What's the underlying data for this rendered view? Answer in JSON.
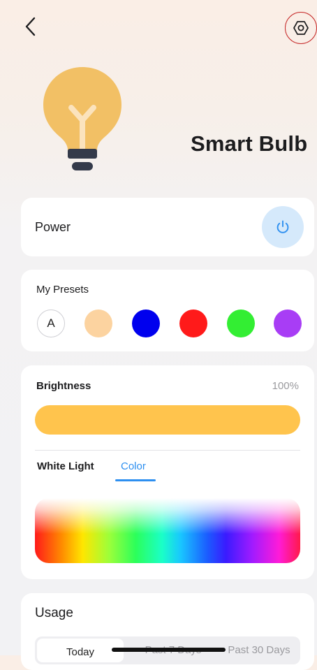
{
  "header": {
    "back_icon": "chevron-left-icon",
    "settings_icon": "hexagon-settings-icon"
  },
  "device": {
    "name": "Smart Bulb",
    "icon": "lightbulb-icon",
    "bulb_color": "#f2c065"
  },
  "power": {
    "label": "Power",
    "icon": "power-icon",
    "accent": "#2d8ff0"
  },
  "presets": {
    "label": "My Presets",
    "auto_label": "A",
    "colors": [
      "#fcd3a0",
      "#0000ee",
      "#ff1a1a",
      "#33ee33",
      "#a83df5"
    ]
  },
  "brightness": {
    "label": "Brightness",
    "value_text": "100%",
    "level": 1.0,
    "bar_color": "#ffc44d"
  },
  "mode_tabs": {
    "white_label": "White Light",
    "color_label": "Color",
    "active": "Color"
  },
  "usage": {
    "label": "Usage",
    "ranges": [
      "Today",
      "Past 7 Days",
      "Past 30 Days"
    ],
    "active": "Today"
  }
}
